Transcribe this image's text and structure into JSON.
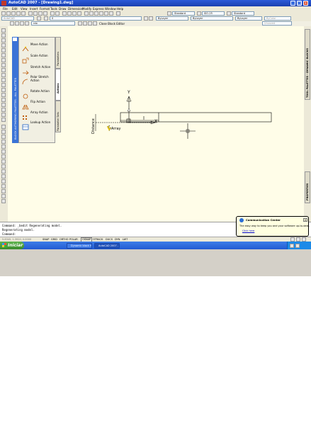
{
  "window": {
    "title": "AutoCAD 2007 - [Drawing1.dwg]",
    "controls": [
      "_",
      "□",
      "×"
    ]
  },
  "menu": [
    "File",
    "Edit",
    "View",
    "Insert",
    "Format",
    "Tools",
    "Draw",
    "Dimension",
    "Modify",
    "Express",
    "Window",
    "Help"
  ],
  "toolbars": {
    "workspace": "AutoCAD",
    "style_text": "Standard",
    "style_dim": "ISO-25",
    "style_table": "Standard",
    "layer": "0",
    "color": "ByLayer",
    "linetype": "ByLayer",
    "lineweight": "ByLayer",
    "plotstyle": "ByColor",
    "block_name": "rdo",
    "close_block_editor": "Close Block Editor",
    "unsaved": "Unsaved"
  },
  "palette": {
    "title": "BLOCK AUTHORING PALETTES - ALL PALETTES",
    "items": [
      {
        "label": "Move Action",
        "icon": "move-action-icon"
      },
      {
        "label": "Scale Action",
        "icon": "scale-action-icon"
      },
      {
        "label": "Stretch Action",
        "icon": "stretch-action-icon"
      },
      {
        "label": "Polar Stretch Action",
        "icon": "polar-stretch-action-icon"
      },
      {
        "label": "Rotate Action",
        "icon": "rotate-action-icon"
      },
      {
        "label": "Flip Action",
        "icon": "flip-action-icon"
      },
      {
        "label": "Array Action",
        "icon": "array-action-icon"
      },
      {
        "label": "Lookup Action",
        "icon": "lookup-action-icon"
      }
    ],
    "tabs": [
      "Parameters",
      "Actions",
      "Parameter Sets"
    ]
  },
  "right_tabs": [
    "TOOL PALETTES - DYNAMIC BLOCKS",
    "PROPERTIES"
  ],
  "drawing": {
    "param_label": "Distance",
    "action_label": "Array",
    "ucs_y": "Y",
    "ucs_x": "X"
  },
  "command_lines": [
    "Command:  _bedit Regenerating model.",
    "Regenerating model.",
    "Command:"
  ],
  "coords": "5.8345, 1.3920, 0.0000",
  "status_buttons": [
    "SNAP",
    "GRID",
    "ORTHO",
    "POLAR",
    "OSNAP",
    "OTRACK",
    "DUCS",
    "DYN",
    "LWT"
  ],
  "taskbar": {
    "start": "Iniciar",
    "tasks": [
      "Dynamic block Help",
      "AutoCAD 2007 - [Dra..."
    ]
  },
  "balloon": {
    "title": "Communication Center",
    "body": "The easy way to keep you and your software up-to-date.",
    "link": "Click here"
  },
  "colors": {
    "titlebar": "#1a3fb0",
    "canvas": "#fffde8",
    "palette_strip": "#3b73d6",
    "taskbar": "#225ad2",
    "start": "#3a8b2c"
  }
}
